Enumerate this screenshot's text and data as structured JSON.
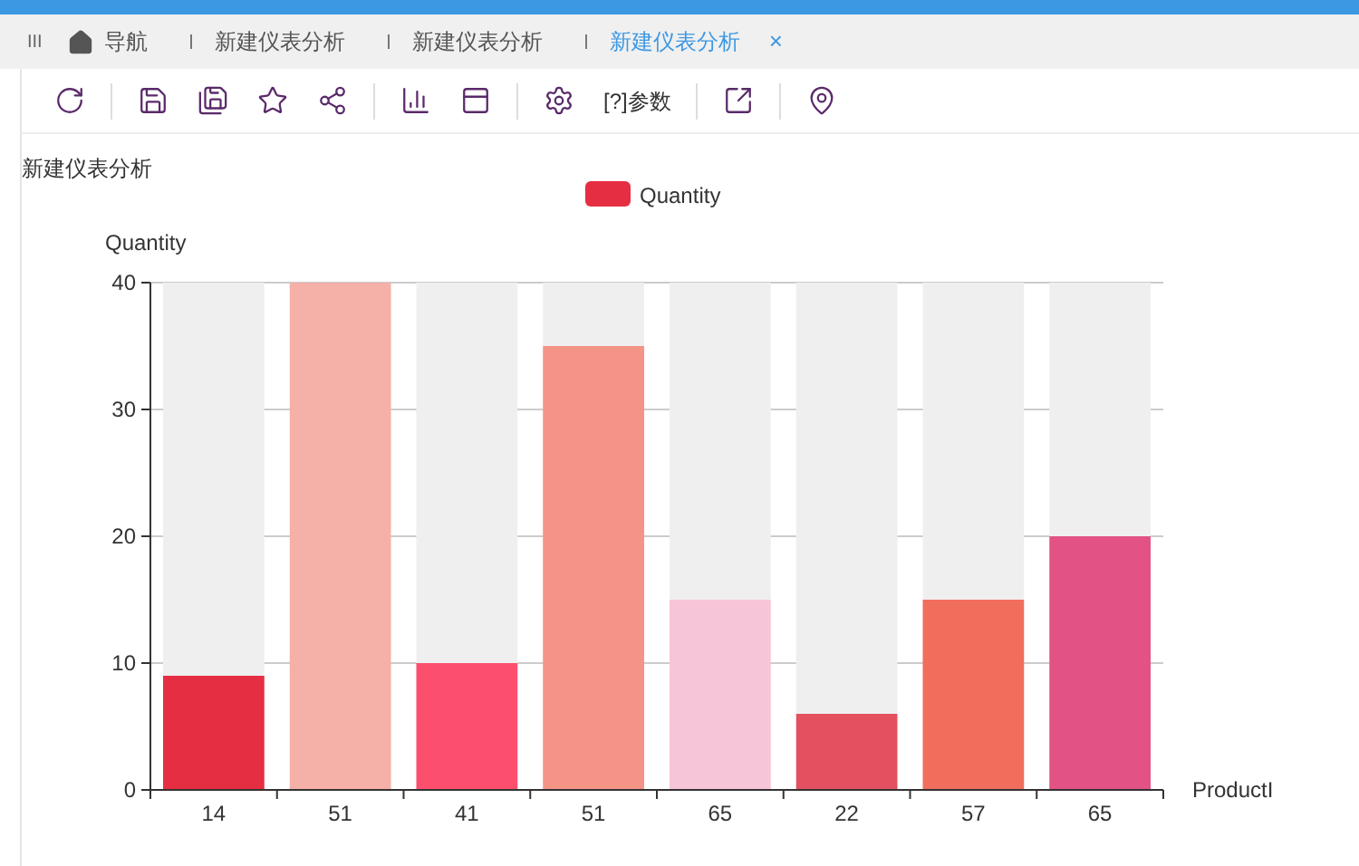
{
  "tab_menu": "III",
  "tabs": [
    {
      "label": "导航",
      "kind": "home",
      "selected": false
    },
    {
      "label": "新建仪表分析",
      "kind": "page",
      "selected": false
    },
    {
      "label": "新建仪表分析",
      "kind": "page",
      "selected": false
    },
    {
      "label": "新建仪表分析",
      "kind": "page",
      "selected": true,
      "close": "×"
    }
  ],
  "toolbar": [
    {
      "kind": "refresh"
    },
    {
      "kind": "separator"
    },
    {
      "kind": "save"
    },
    {
      "kind": "save-as"
    },
    {
      "kind": "star"
    },
    {
      "kind": "share"
    },
    {
      "kind": "separator"
    },
    {
      "kind": "chart"
    },
    {
      "kind": "layout"
    },
    {
      "kind": "separator"
    },
    {
      "kind": "settings"
    },
    {
      "kind": "text",
      "label": "[?]参数"
    },
    {
      "kind": "separator"
    },
    {
      "kind": "export"
    },
    {
      "kind": "separator"
    },
    {
      "kind": "location"
    }
  ],
  "dashboard": {
    "title": "新建仪表分析",
    "chart_data": {
      "type": "bar",
      "grid": true,
      "xlabel": "ProductI",
      "ylabel": "Quantity",
      "categories": [
        "14",
        "51",
        "41",
        "51",
        "65",
        "22",
        "57",
        "65"
      ],
      "ylim": [
        0,
        40
      ],
      "yticks": [
        0,
        10,
        20,
        30,
        40
      ],
      "stacked": true,
      "series": [
        {
          "name": "Quantity",
          "values": [
            9,
            40,
            10,
            35,
            15,
            6,
            15,
            20
          ],
          "colors": [
            "#e62e42",
            "#f5b0a8",
            "#fc4f6e",
            "#f39487",
            "#f7c5d8",
            "#e4505f",
            "#f16d5c",
            "#e25285"
          ]
        },
        {
          "color": "#efefef",
          "values": [
            31,
            0,
            30,
            5,
            25,
            34,
            25,
            20
          ]
        }
      ]
    }
  }
}
